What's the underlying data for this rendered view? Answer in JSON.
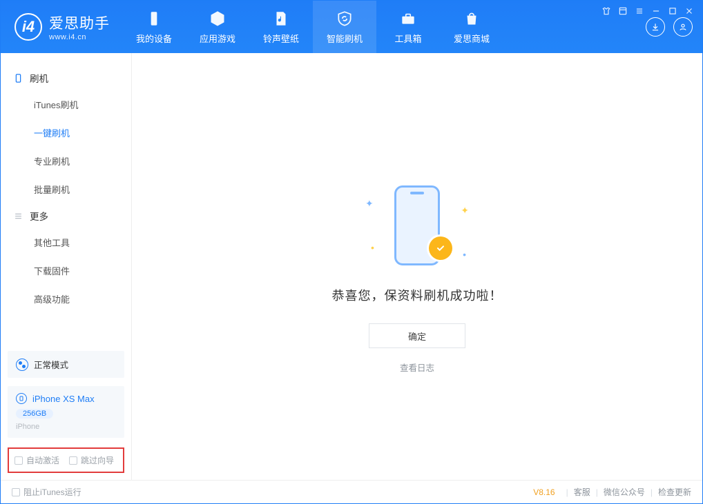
{
  "app": {
    "name": "爱思助手",
    "url": "www.i4.cn"
  },
  "nav": {
    "tabs": [
      {
        "label": "我的设备"
      },
      {
        "label": "应用游戏"
      },
      {
        "label": "铃声壁纸"
      },
      {
        "label": "智能刷机"
      },
      {
        "label": "工具箱"
      },
      {
        "label": "爱思商城"
      }
    ]
  },
  "sidebar": {
    "group1_title": "刷机",
    "group1_items": [
      {
        "label": "iTunes刷机"
      },
      {
        "label": "一键刷机"
      },
      {
        "label": "专业刷机"
      },
      {
        "label": "批量刷机"
      }
    ],
    "group2_title": "更多",
    "group2_items": [
      {
        "label": "其他工具"
      },
      {
        "label": "下载固件"
      },
      {
        "label": "高级功能"
      }
    ],
    "mode_label": "正常模式",
    "device": {
      "name": "iPhone XS Max",
      "storage": "256GB",
      "type": "iPhone"
    },
    "opt_auto_activate": "自动激活",
    "opt_skip_guide": "跳过向导"
  },
  "main": {
    "success_text": "恭喜您，保资料刷机成功啦！",
    "ok_button": "确定",
    "view_log": "查看日志"
  },
  "footer": {
    "block_itunes": "阻止iTunes运行",
    "version": "V8.16",
    "links": [
      "客服",
      "微信公众号",
      "检查更新"
    ]
  }
}
